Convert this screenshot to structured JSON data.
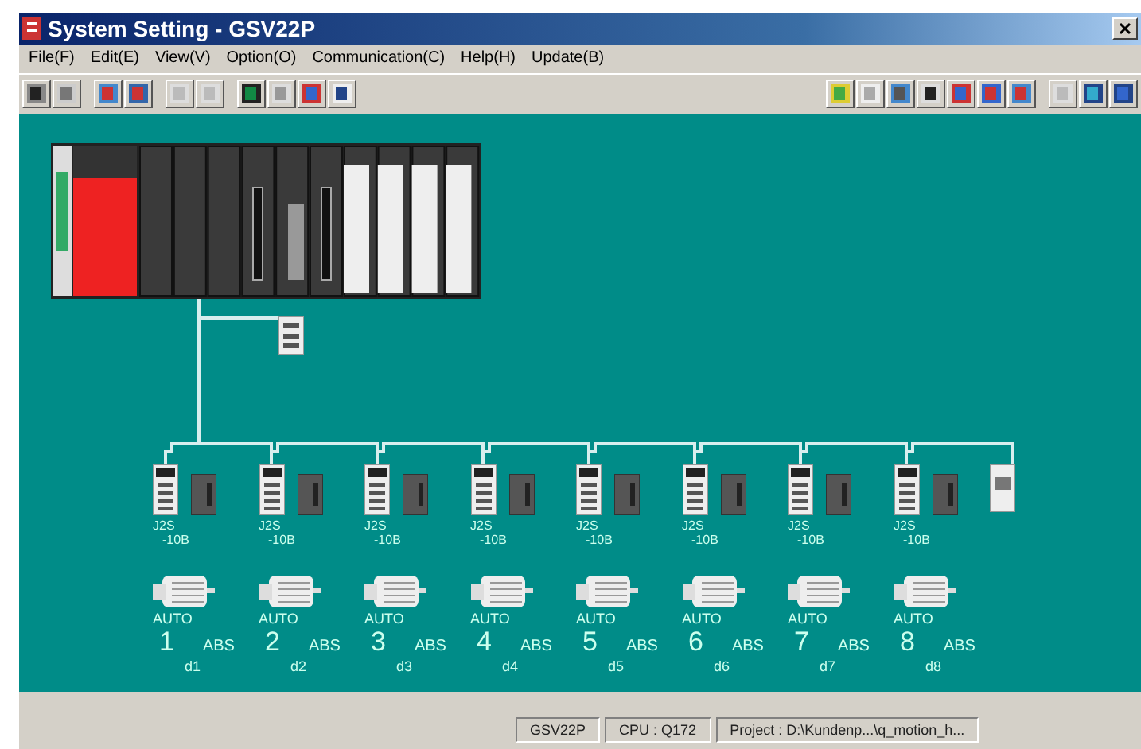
{
  "window": {
    "title": "System Setting - GSV22P"
  },
  "menu": [
    "File(F)",
    "Edit(E)",
    "View(V)",
    "Option(O)",
    "Communication(C)",
    "Help(H)",
    "Update(B)"
  ],
  "axes": [
    {
      "amp_model": "J2S",
      "amp_suffix": "-10B",
      "mode": "AUTO",
      "number": "1",
      "encoder": "ABS",
      "name": "d1"
    },
    {
      "amp_model": "J2S",
      "amp_suffix": "-10B",
      "mode": "AUTO",
      "number": "2",
      "encoder": "ABS",
      "name": "d2"
    },
    {
      "amp_model": "J2S",
      "amp_suffix": "-10B",
      "mode": "AUTO",
      "number": "3",
      "encoder": "ABS",
      "name": "d3"
    },
    {
      "amp_model": "J2S",
      "amp_suffix": "-10B",
      "mode": "AUTO",
      "number": "4",
      "encoder": "ABS",
      "name": "d4"
    },
    {
      "amp_model": "J2S",
      "amp_suffix": "-10B",
      "mode": "AUTO",
      "number": "5",
      "encoder": "ABS",
      "name": "d5"
    },
    {
      "amp_model": "J2S",
      "amp_suffix": "-10B",
      "mode": "AUTO",
      "number": "6",
      "encoder": "ABS",
      "name": "d6"
    },
    {
      "amp_model": "J2S",
      "amp_suffix": "-10B",
      "mode": "AUTO",
      "number": "7",
      "encoder": "ABS",
      "name": "d7"
    },
    {
      "amp_model": "J2S",
      "amp_suffix": "-10B",
      "mode": "AUTO",
      "number": "8",
      "encoder": "ABS",
      "name": "d8"
    }
  ],
  "status_bar": [
    "GSV22P",
    "CPU : Q172",
    "Project : D:\\Kundenp...\\q_motion_h..."
  ]
}
